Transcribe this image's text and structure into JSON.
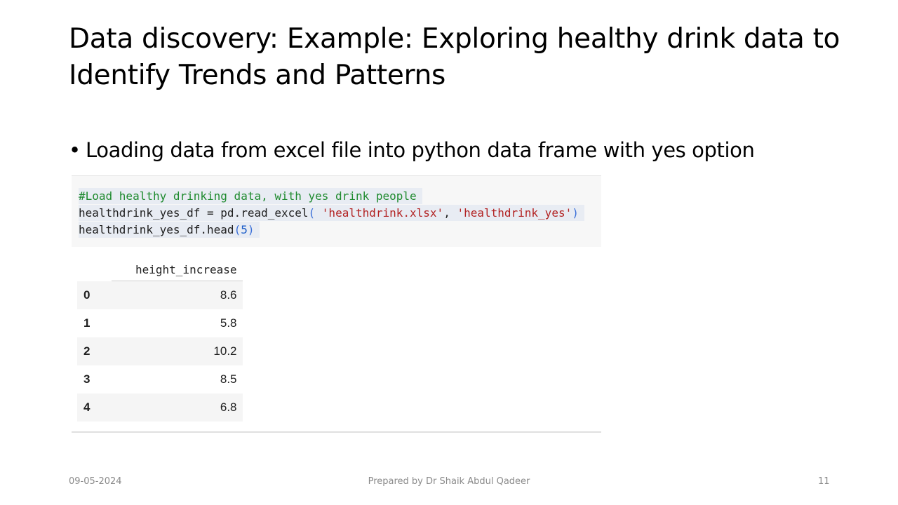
{
  "slide": {
    "title": "Data discovery: Example: Exploring healthy drink data to Identify Trends and Patterns",
    "bullet": "Loading data from excel file into python data frame  with yes option"
  },
  "code": {
    "comment": "#Load healthy drinking data, with yes drink people",
    "line2_var": "healthdrink_yes_df = pd.read_excel",
    "line2_open": "(",
    "line2_arg1": "'healthdrink.xlsx'",
    "line2_sep": ", ",
    "line2_arg2": "'healthdrink_yes'",
    "line2_close": ")",
    "line3_call": "healthdrink_yes_df.head",
    "line3_open": "(",
    "line3_arg": "5",
    "line3_close": ")"
  },
  "output": {
    "columns": [
      "height_increase"
    ],
    "rows": [
      {
        "index": "0",
        "value": "8.6"
      },
      {
        "index": "1",
        "value": "5.8"
      },
      {
        "index": "2",
        "value": "10.2"
      },
      {
        "index": "3",
        "value": "8.5"
      },
      {
        "index": "4",
        "value": "6.8"
      }
    ]
  },
  "footer": {
    "date": "09-05-2024",
    "author": "Prepared by Dr Shaik Abdul Qadeer",
    "page_number": "11"
  },
  "colors": {
    "comment": "#1e8a2e",
    "string": "#b22222",
    "number": "#1a5cc8",
    "code_background": "#f7f7f7"
  }
}
